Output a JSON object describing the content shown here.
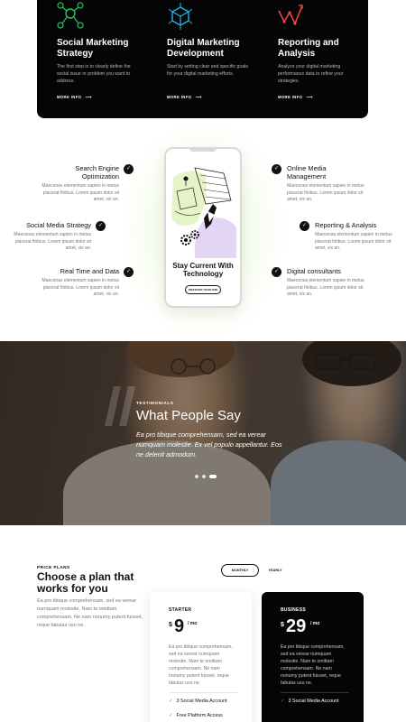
{
  "services": [
    {
      "title": "Social Marketing Strategy",
      "desc": "The first step is to clearly define the social issue or problem you want to address.",
      "more": "MORE INFO",
      "icon": "network-icon",
      "color": "#22c55e"
    },
    {
      "title": "Digital Marketing Development",
      "desc": "Start by setting clear and specific goals for your digital marketing efforts.",
      "more": "MORE INFO",
      "icon": "cube-icon",
      "color": "#22b8e6"
    },
    {
      "title": "Reporting and Analysis",
      "desc": "Analyze your digital marketing performance data to refine your strategies.",
      "more": "MORE INFO",
      "icon": "trend-chart-icon",
      "color": "#ef4444"
    }
  ],
  "features": {
    "left": [
      {
        "title": "Search Engine Optimization",
        "desc": "Maecenas elementum sapien in metus placerat finibus. Lorem ipsum dolor sit amet, vix an."
      },
      {
        "title": "Social Media Strategy",
        "desc": "Maecenas elementum sapien in metus placerat finibus. Lorem ipsum dolor sit amet, vix an."
      },
      {
        "title": "Real Time and Data",
        "desc": "Maecenas elementum sapien in metus placerat finibus. Lorem ipsum dolor sit amet, vix an."
      }
    ],
    "right": [
      {
        "title": "Online Media Management",
        "desc": "Maecenas elementum sapien in metus placerat finibus. Lorem ipsum dolor sit amet, vix an."
      },
      {
        "title": "Reporting & Analysis",
        "desc": "Maecenas elementum sapien in metus placerat finibus. Lorem ipsum dolor sit amet, vix an."
      },
      {
        "title": "Digital consultants",
        "desc": "Maecenas elementum sapien in metus placerat finibus. Lorem ipsum dolor sit amet, vix an."
      }
    ],
    "phone_title": "Stay Current With Technology",
    "phone_button": "DISCOVER YOUR SITE"
  },
  "testimonials": {
    "label": "TESTIMONIALS",
    "heading": "What People Say",
    "quote": "Ea pro tibique comprehensam, sed ea verear numquam molestie. Ex vel populo appellantur. Eos ne delenit admodum.",
    "slides": 3,
    "active_slide": 3
  },
  "pricing": {
    "label": "PRICE PLANS",
    "title": "Choose a plan that works for you",
    "desc": "Ea pro tibique comprehensam, sed ea verear numquam molestie. Nam te omittam comprehensam. Ne nam nonumy putent fuisset, reque fabulas usu ne.",
    "toggle": {
      "monthly": "MONTHLY",
      "yearly": "YEARLY",
      "selected": "monthly"
    },
    "plans": [
      {
        "name": "STARTER",
        "currency": "$",
        "amount": "9",
        "period": "/ mo",
        "desc": "Ea pro tibique comprehensam, sed ea verear numquam molestie. Nam te omittam comprehensam. Ne nam nonumy putent fuisset, reque fabulas usu ne.",
        "features": [
          "3 Social Media Account",
          "Free Platform Access"
        ]
      },
      {
        "name": "BUSINESS",
        "currency": "$",
        "amount": "29",
        "period": "/ mo",
        "desc": "Ea pro tibique comprehensam, sed ea verear numquam molestie. Nam te omittam comprehensam. Ne nam nonumy putent fuisset, reque fabulas usu ne.",
        "features": [
          "3 Social Media Account"
        ]
      }
    ]
  },
  "colors": {
    "dark": "#050505",
    "accent_check": "#1db3a6",
    "phone_green": "#e4f4c7",
    "phone_purple": "#e3d6f5"
  }
}
